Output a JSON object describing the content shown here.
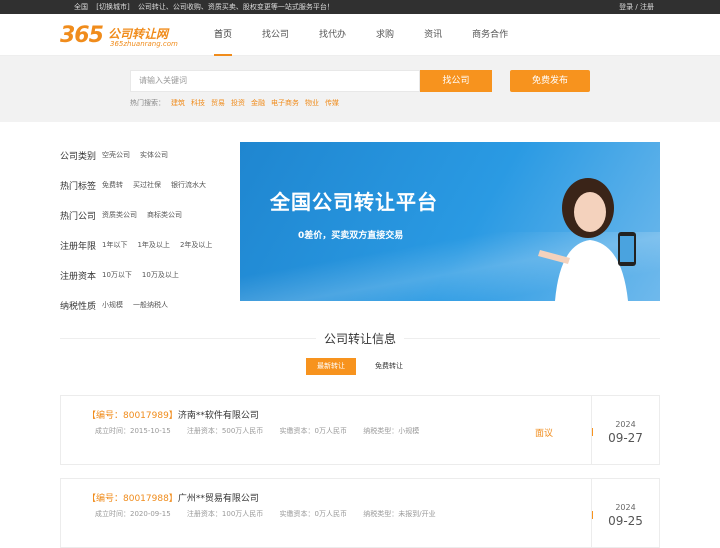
{
  "topbar": {
    "region": "全国",
    "switch_city": "[切换城市]",
    "slogan": "公司转让、公司收购、资质买卖、股权变更等一站式服务平台！",
    "login": "登录",
    "sep": "/",
    "register": "注册"
  },
  "logo": {
    "num": "365",
    "cn": "公司转让网",
    "en": "365zhuanrang.com"
  },
  "nav": [
    {
      "label": "首页",
      "active": true
    },
    {
      "label": "找公司"
    },
    {
      "label": "找代办"
    },
    {
      "label": "求购"
    },
    {
      "label": "资讯"
    },
    {
      "label": "商务合作"
    }
  ],
  "search": {
    "placeholder": "请输入关键词",
    "find_button": "找公司",
    "publish_button": "免费发布",
    "hot_label": "热门搜索：",
    "hot_links": [
      "建筑",
      "科技",
      "贸易",
      "投资",
      "金融",
      "电子商务",
      "物业",
      "传媒"
    ]
  },
  "filters": [
    {
      "label": "公司类别",
      "options": [
        "空壳公司",
        "实体公司"
      ]
    },
    {
      "label": "热门标签",
      "options": [
        "免费转",
        "买过社保",
        "银行流水大"
      ]
    },
    {
      "label": "热门公司",
      "options": [
        "资质类公司",
        "商标类公司"
      ]
    },
    {
      "label": "注册年限",
      "options": [
        "1年以下",
        "1年及以上",
        "2年及以上"
      ]
    },
    {
      "label": "注册资本",
      "options": [
        "10万以下",
        "10万及以上"
      ]
    },
    {
      "label": "纳税性质",
      "options": [
        "小规模",
        "一般纳税人"
      ]
    }
  ],
  "banner": {
    "headline": "全国公司转让平台",
    "sub": "0差价，买卖双方直接交易"
  },
  "section": {
    "title": "公司转让信息",
    "tab_latest": "最新转让",
    "tab_free": "免费转让"
  },
  "listings": [
    {
      "code": "【编号：80017989】",
      "name": "济南**软件有限公司",
      "founded": "成立时间：2015-10-15",
      "reg_capital": "注册资本：500万人民币",
      "paid_capital": "实缴资本：0万人民币",
      "tax_type": "纳税类型：小规模",
      "price": "面议",
      "year": "2024",
      "date": "09-27"
    },
    {
      "code": "【编号：80017988】",
      "name": "广州**贸易有限公司",
      "founded": "成立时间：2020-09-15",
      "reg_capital": "注册资本：100万人民币",
      "paid_capital": "实缴资本：0万人民币",
      "tax_type": "纳税类型：未报到/开业",
      "price": "",
      "year": "2024",
      "date": "09-25"
    }
  ],
  "colors": {
    "accent": "#f7931e",
    "banner": "#1f86d0",
    "topbar": "#303030"
  }
}
